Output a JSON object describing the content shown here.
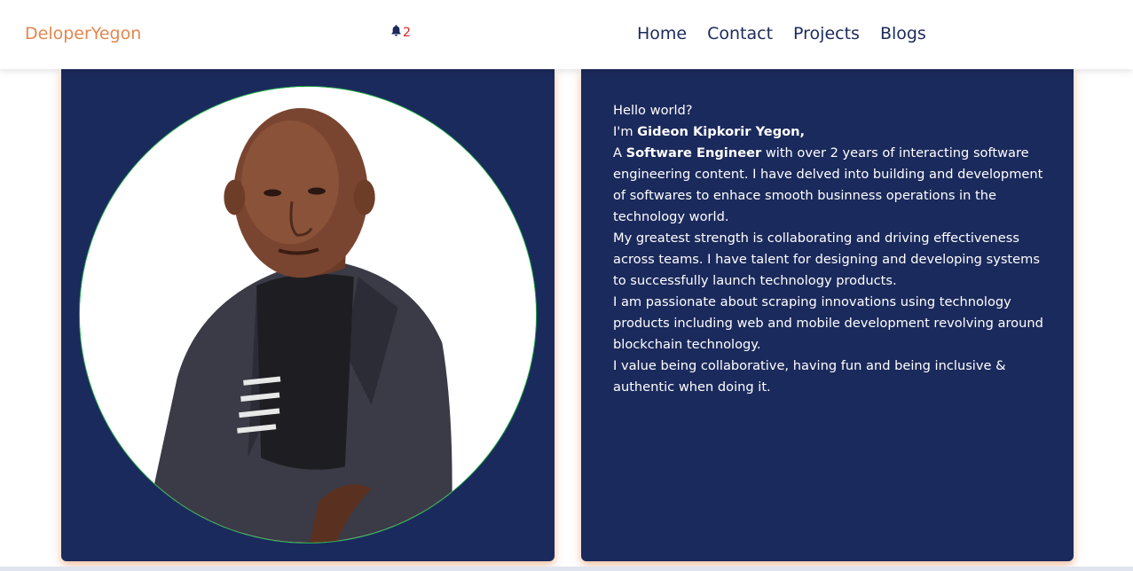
{
  "navbar": {
    "brand": "DeloperYegon",
    "notifications": {
      "icon": "bell-icon",
      "count": "2"
    },
    "links": [
      "Home",
      "Contact",
      "Projects",
      "Blogs"
    ]
  },
  "profile": {
    "photo": "portrait-photo",
    "bio": {
      "greeting": "Hello world?",
      "intro_prefix": "I'm ",
      "name": "Gideon Kipkorir Yegon,",
      "role_prefix": "A ",
      "role": "Software Engineer",
      "role_rest": " with over 2 years of interacting software engineering content. I have delved into building and development of softwares to enhace smooth businness operations in the technology world.",
      "paragraph_2": "My greatest strength is collaborating and driving effectiveness across teams. I have talent for designing and developing systems to successfully launch technology products.",
      "paragraph_3": "I am passionate about scraping innovations using technology products including web and mobile development revolving around blockchain technology.",
      "paragraph_4": "I value being collaborative, having fun and being inclusive & authentic when doing it."
    }
  },
  "colors": {
    "brand": "#e2874d",
    "nav_text": "#1c2a5c",
    "card_bg": "#1b2a5c",
    "badge": "#e02424",
    "circle_border": "#25b34a"
  }
}
